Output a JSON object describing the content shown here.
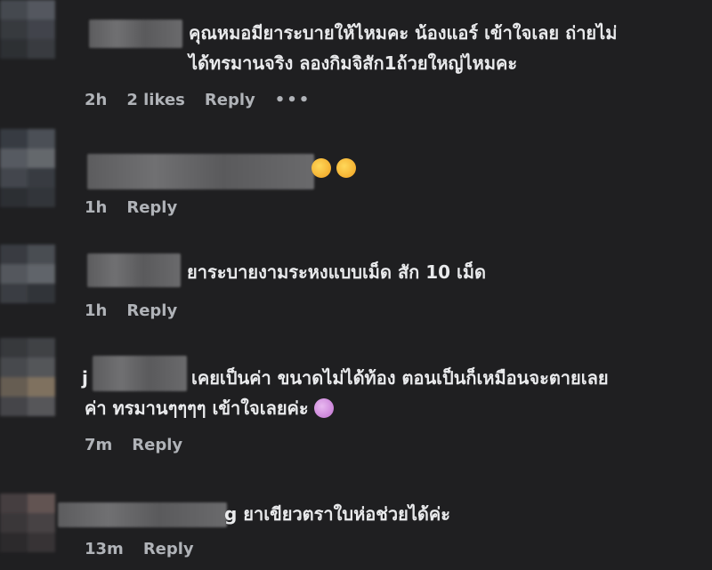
{
  "comments": [
    {
      "text_lines": [
        "คุณหมอมียาระบายให้ไหมคะ น้องแอร์ เข้าใจเลย ถ่ายไม่",
        "ได้ทรมานจริง ลองกิมจิสัก1ถ้วยใหญ่ไหมคะ"
      ],
      "time": "2h",
      "likes": "2 likes",
      "reply": "Reply",
      "more": "•••"
    },
    {
      "text_lines": [
        ""
      ],
      "emoji": [
        "grinning-squint-icon",
        "rolling-laughing-icon"
      ],
      "time": "1h",
      "reply": "Reply"
    },
    {
      "text_lines": [
        "ยาระบายงามระหงแบบเม็ด สัก 10 เม็ด"
      ],
      "time": "1h",
      "reply": "Reply"
    },
    {
      "name_prefix": "j",
      "text_lines": [
        "เคยเป็นค่า ขนาดไม่ได้ท้อง ตอนเป็นก็เหมือนจะตายเลย",
        "ค่า ทรมานๆๆๆๆ เข้าใจเลยค่ะ"
      ],
      "emoji": [
        "screaming-face-icon"
      ],
      "time": "7m",
      "reply": "Reply"
    },
    {
      "text_lines": [
        "g ยาเขียวตราใบห่อช่วยได้ค่ะ"
      ],
      "time": "13m",
      "reply": "Reply"
    }
  ],
  "colors": {
    "background": "#1f1f21",
    "text": "#e9eaec",
    "meta": "#b0b3b8"
  }
}
